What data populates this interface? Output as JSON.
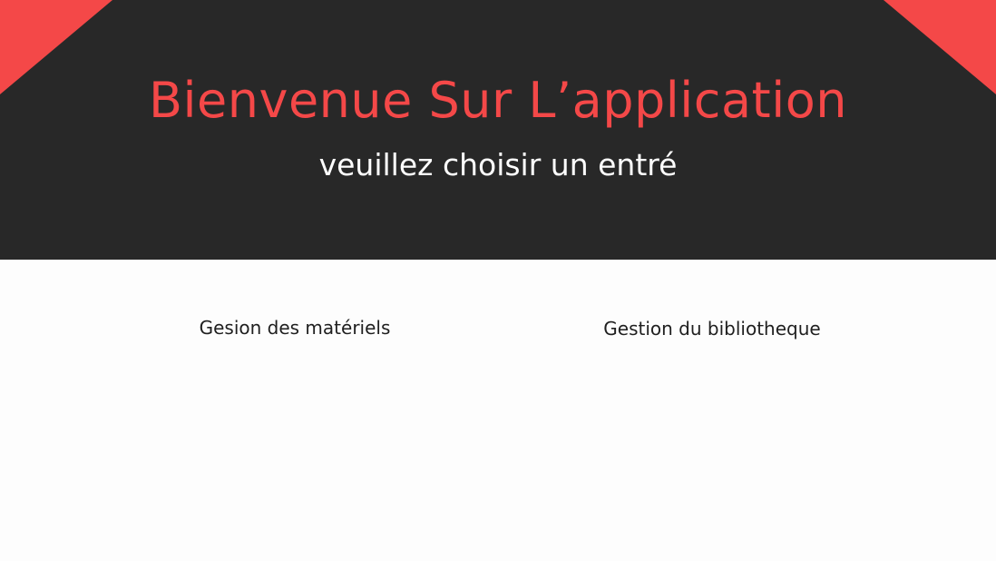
{
  "header": {
    "title": "Bienvenue Sur L’application",
    "subtitle": "veuillez choisir un entré",
    "accent_color": "#f44848",
    "background_color": "#282828"
  },
  "choices": [
    {
      "label": "Gesion des matériels"
    },
    {
      "label": "Gestion du bibliotheque"
    }
  ]
}
